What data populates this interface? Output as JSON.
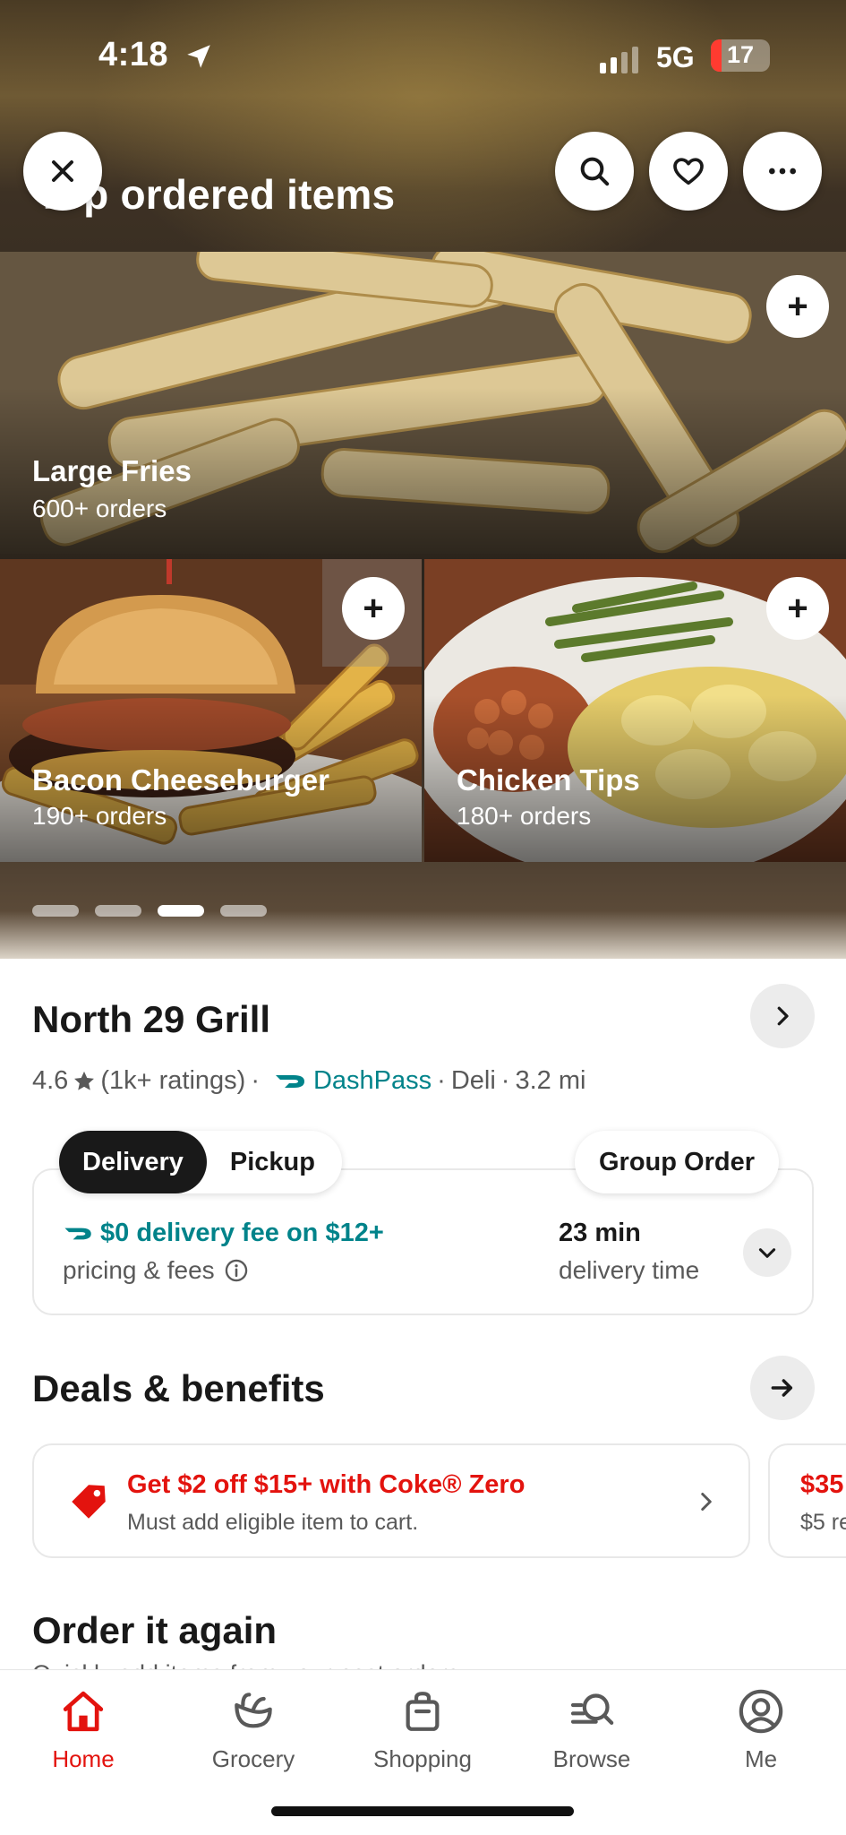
{
  "status_bar": {
    "time": "4:18",
    "network": "5G",
    "battery": "17"
  },
  "header": {
    "section_title": "Top ordered items"
  },
  "top_items": [
    {
      "name": "Large Fries",
      "orders": "600+ orders",
      "add_label": "+"
    },
    {
      "name": "Bacon Cheeseburger",
      "orders": "190+ orders",
      "add_label": "+"
    },
    {
      "name": "Chicken Tips",
      "orders": "180+ orders",
      "add_label": "+"
    }
  ],
  "carousel": {
    "pages": 4,
    "active_page": 3
  },
  "store": {
    "name": "North 29 Grill",
    "rating": "4.6",
    "ratings_count": "(1k+ ratings)",
    "dashpass": "DashPass",
    "category": "Deli",
    "distance": "3.2 mi",
    "separator": "·"
  },
  "order_mode": {
    "delivery_label": "Delivery",
    "pickup_label": "Pickup",
    "selected": "Delivery",
    "group_order_label": "Group Order"
  },
  "delivery_info": {
    "fee": "$0 delivery fee on $12+",
    "fee_sub": "pricing & fees",
    "eta": "23 min",
    "eta_sub": "delivery time"
  },
  "deals": {
    "title": "Deals & benefits",
    "items": [
      {
        "title": "Get $2 off $15+ with Coke® Zero",
        "subtitle": "Must add eligible item to cart."
      },
      {
        "title": "$35",
        "subtitle": "$5 re"
      }
    ]
  },
  "order_again": {
    "title": "Order it again",
    "subtitle": "Quickly add items from your past orders"
  },
  "tabbar": {
    "items": [
      {
        "label": "Home",
        "icon": "home-icon",
        "active": true
      },
      {
        "label": "Grocery",
        "icon": "grocery-icon",
        "active": false
      },
      {
        "label": "Shopping",
        "icon": "shopping-bag-icon",
        "active": false
      },
      {
        "label": "Browse",
        "icon": "browse-icon",
        "active": false
      },
      {
        "label": "Me",
        "icon": "profile-icon",
        "active": false
      }
    ]
  },
  "colors": {
    "brand_red": "#e3130e",
    "dashpass_teal": "#00838a",
    "text_dark": "#191919",
    "text_muted": "#595959"
  }
}
